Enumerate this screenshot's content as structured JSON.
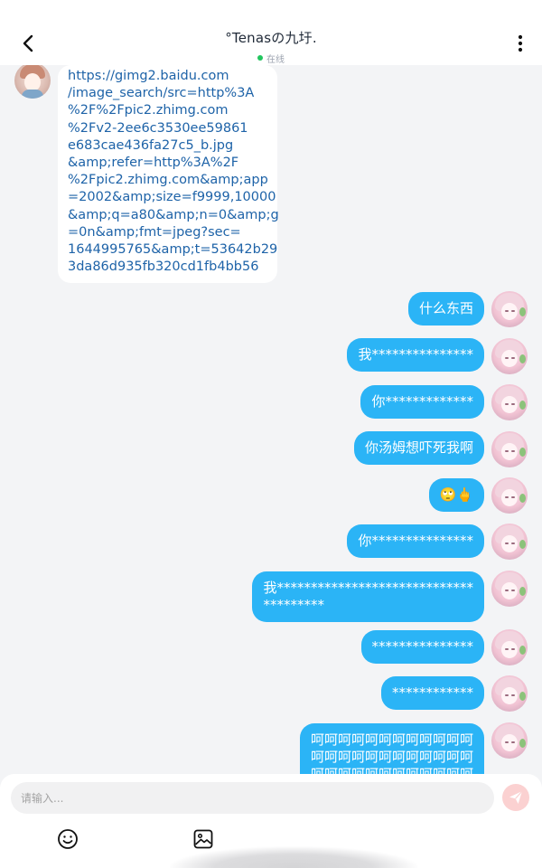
{
  "header": {
    "title": "°Tenasの九圩.",
    "status": "在线"
  },
  "messages": {
    "incoming": {
      "lines": [
        "https://gimg2.baidu.com",
        "/image_search/src=http%3A",
        "%2F%2Fpic2.zhimg.com",
        "%2Fv2-2ee6c3530ee59861",
        "e683cae436fa27c5_b.jpg",
        "&amp;refer=http%3A%2F",
        "%2Fpic2.zhimg.com&amp;app",
        "=2002&amp;size=f9999,10000",
        "&amp;q=a80&amp;n=0&amp;g",
        "=0n&amp;fmt=jpeg?sec=",
        "1644995765&amp;t=53642b29",
        "3da86d935fb320cd1fb4bb56"
      ]
    },
    "outgoing": [
      {
        "text": "什么东西"
      },
      {
        "text": "我***************"
      },
      {
        "text": "你*************"
      },
      {
        "text": "你汤姆想吓死我啊"
      },
      {
        "text": "🙄🖕"
      },
      {
        "text": "你***************"
      },
      {
        "line1": "我*****************************",
        "line2": "*********"
      },
      {
        "text": "***************"
      },
      {
        "text": "************"
      },
      {
        "line1": "呵呵呵呵呵呵呵呵呵呵呵呵",
        "line2": "呵呵呵呵呵呵呵呵呵呵呵呵",
        "line3": "呵呵呵呵呵呵呵呵呵呵呵呵"
      }
    ]
  },
  "input": {
    "placeholder": "请输入..."
  },
  "icons": {
    "back": "chevron-left-icon",
    "more": "more-vertical-icon",
    "send": "send-icon",
    "emoji": "smiley-icon",
    "image": "image-icon"
  },
  "colors": {
    "accent": "#2bb4f6",
    "online": "#22c55e",
    "link": "#1e63a8",
    "send_disabled": "#fbd1d1"
  }
}
